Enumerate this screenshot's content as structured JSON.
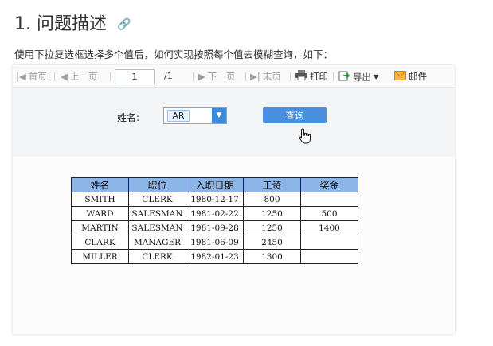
{
  "heading": {
    "title": "1. 问题描述",
    "link_icon": "link-icon"
  },
  "description": "使用下拉复选框选择多个值后，如何实现按照每个值去模糊查询，如下：",
  "toolbar": {
    "first": "首页",
    "prev": "上一页",
    "page_value": "1",
    "page_total": "/1",
    "next": "下一页",
    "last": "末页",
    "print": "打印",
    "export": "导出",
    "mail": "邮件"
  },
  "params": {
    "name_label": "姓名:",
    "selected_tag": "AR",
    "query_button": "查询"
  },
  "table": {
    "headers": [
      "姓名",
      "职位",
      "入职日期",
      "工资",
      "奖金"
    ],
    "rows": [
      [
        "SMITH",
        "CLERK",
        "1980-12-17",
        "800",
        ""
      ],
      [
        "WARD",
        "SALESMAN",
        "1981-02-22",
        "1250",
        "500"
      ],
      [
        "MARTIN",
        "SALESMAN",
        "1981-09-28",
        "1250",
        "1400"
      ],
      [
        "CLARK",
        "MANAGER",
        "1981-06-09",
        "2450",
        ""
      ],
      [
        "MILLER",
        "CLERK",
        "1982-01-23",
        "1300",
        ""
      ]
    ]
  },
  "colors": {
    "header_bg": "#8db6e8",
    "button_bg": "#4a90e2",
    "param_bg": "#f4f5f7"
  }
}
